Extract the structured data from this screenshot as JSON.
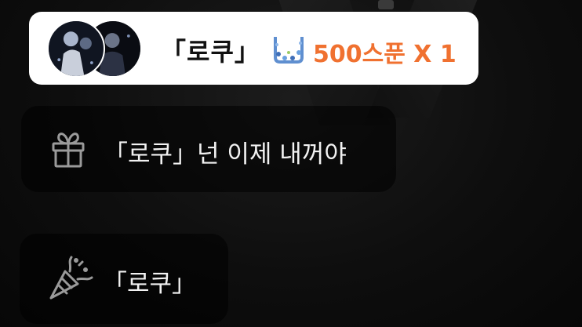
{
  "gift_banner": {
    "sender": "「로쿠」",
    "currency_icon": "spoon-icon",
    "amount": "500스푼 X 1",
    "amount_color": "#f07130"
  },
  "messages": [
    {
      "icon": "gift-icon",
      "text": "「로쿠」넌 이제 내꺼야"
    },
    {
      "icon": "party-popper-icon",
      "text": "「로쿠」"
    }
  ]
}
